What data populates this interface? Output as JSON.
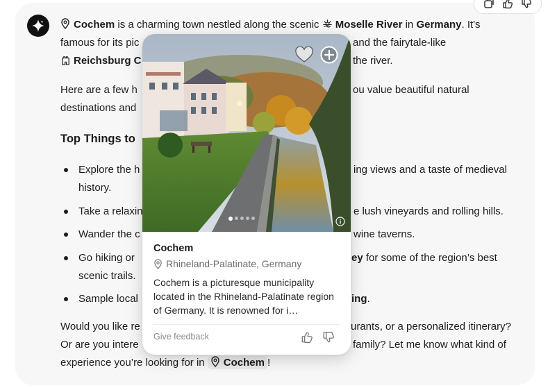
{
  "message": {
    "p1_before": "is a charming town nestled along the scenic",
    "town": "Cochem",
    "river": "Moselle River",
    "in_word": "in",
    "country": "Germany",
    "p1_after": ". It's",
    "line2_a": "famous for its pic",
    "line2_b": "and the fairytale-like",
    "castle": "Reichsburg C",
    "line3_b": "the river.",
    "p2_line1_a": "Here are a few h",
    "p2_line1_b": "ou value beautiful natural",
    "p2_line2": "destinations and",
    "heading": "Top Things to",
    "bullets": [
      {
        "a": "Explore the h",
        "b": "ing views and a taste of medieval",
        "c": "history."
      },
      {
        "a": "Take a relaxin",
        "b": "e lush vineyards and rolling hills."
      },
      {
        "a": "Wander the c",
        "b": "wine taverns."
      },
      {
        "a": "Go hiking or",
        "b_bold": "ey",
        "b": " for some of the region’s best",
        "c": "scenic trails."
      },
      {
        "a": "Sample local",
        "b_bold": "ing",
        "b": "."
      }
    ],
    "closing_l1_a": "Would you like re",
    "closing_l1_b": "urants, or a personalized itinerary?",
    "closing_l2_a": "Or are you intere",
    "closing_l2_b": "family? Let me know what kind of",
    "closing_l3_a": "experience you’re looking for in",
    "closing_town": "Cochem",
    "closing_end": "!"
  },
  "card": {
    "title": "Cochem",
    "location": "Rhineland-Palatinate, Germany",
    "description": "Cochem is a picturesque municipality located in the Rhineland-Palatinate region of Germany. It is renowned for i…",
    "feedback": "Give feedback",
    "photo_count": 5,
    "photo_active_index": 0
  },
  "icons": [
    "sparkle-icon",
    "map-pin-icon",
    "river-icon",
    "castle-icon",
    "heart-icon",
    "plus-circle-icon",
    "info-icon",
    "thumbs-up-icon",
    "thumbs-down-icon",
    "copy-icon"
  ]
}
